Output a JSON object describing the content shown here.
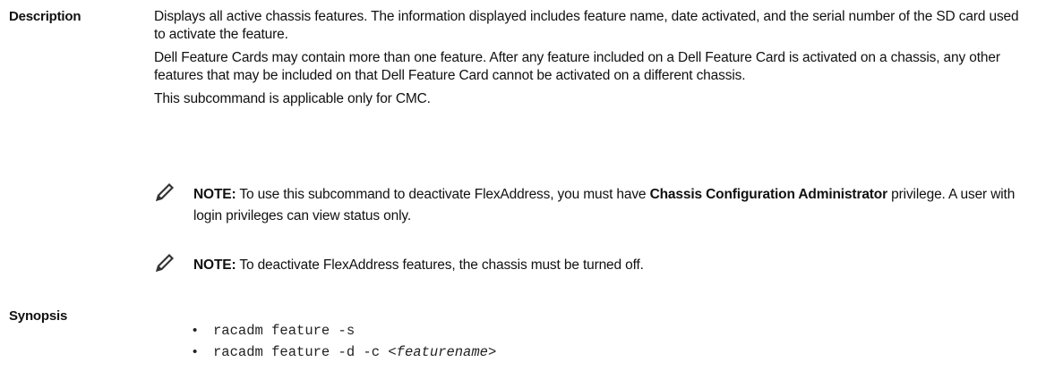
{
  "description": {
    "label": "Description",
    "paragraphs": [
      "Displays all active chassis features. The information displayed includes feature name, date activated, and the serial number of the SD card used to activate the feature.",
      "Dell Feature Cards may contain more than one feature. After any feature included on a Dell Feature Card is activated on a chassis, any other features that may be included on that Dell Feature Card cannot be activated on a different chassis.",
      "This subcommand is applicable only for CMC."
    ],
    "notes": [
      {
        "icon": "pencil-note-icon",
        "prefix": "NOTE:",
        "text_before": " To use this subcommand to deactivate FlexAddress, you must have ",
        "bold_term": "Chassis Configuration Administrator",
        "text_after": " privilege. A user with login privileges can view status only."
      },
      {
        "icon": "pencil-note-icon",
        "prefix": "NOTE:",
        "text": " To deactivate FlexAddress features, the chassis must be turned off."
      }
    ]
  },
  "synopsis": {
    "label": "Synopsis",
    "commands": [
      {
        "bullet": "•",
        "text": "racadm feature -s"
      },
      {
        "bullet": "•",
        "text": "racadm feature -d -c <",
        "placeholder": "featurename",
        "suffix": ">"
      }
    ]
  }
}
